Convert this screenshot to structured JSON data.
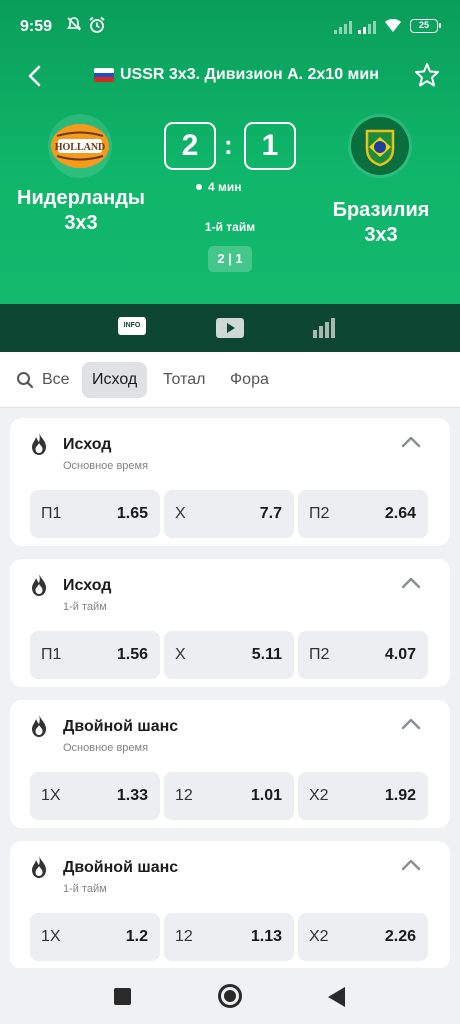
{
  "status": {
    "time": "9:59",
    "battery": "25"
  },
  "header": {
    "league": "USSR 3x3. Дивизион А. 2x10 мин",
    "home_team": "Нидерланды 3x3",
    "away_team": "Бразилия 3x3",
    "home_logo_text": "HOLLAND",
    "home_score": "2",
    "away_score": "1",
    "score_sep": ":",
    "time": "4 мин",
    "period": "1-й тайм",
    "period_score": "2 | 1"
  },
  "tabs": {
    "info_label": "INFO"
  },
  "filters": [
    "Все",
    "Исход",
    "Тотал",
    "Фора"
  ],
  "markets": [
    {
      "title": "Исход",
      "subtitle": "Основное время",
      "odds": [
        {
          "label": "П1",
          "value": "1.65"
        },
        {
          "label": "X",
          "value": "7.7"
        },
        {
          "label": "П2",
          "value": "2.64"
        }
      ]
    },
    {
      "title": "Исход",
      "subtitle": "1-й тайм",
      "odds": [
        {
          "label": "П1",
          "value": "1.56"
        },
        {
          "label": "X",
          "value": "5.11"
        },
        {
          "label": "П2",
          "value": "4.07"
        }
      ]
    },
    {
      "title": "Двойной шанс",
      "subtitle": "Основное время",
      "odds": [
        {
          "label": "1X",
          "value": "1.33"
        },
        {
          "label": "12",
          "value": "1.01"
        },
        {
          "label": "X2",
          "value": "1.92"
        }
      ]
    },
    {
      "title": "Двойной шанс",
      "subtitle": "1-й тайм",
      "odds": [
        {
          "label": "1X",
          "value": "1.2"
        },
        {
          "label": "12",
          "value": "1.13"
        },
        {
          "label": "X2",
          "value": "2.26"
        }
      ]
    }
  ],
  "colors": {
    "header_green": "#0fb56a",
    "tabbar_dark": "#0d4632",
    "odd_bg": "#eceef1"
  }
}
